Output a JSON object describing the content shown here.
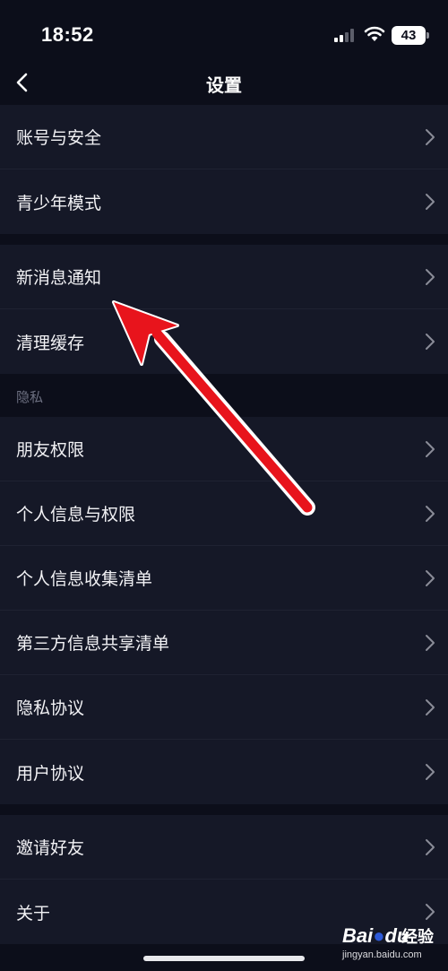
{
  "status_bar": {
    "time": "18:52",
    "battery": "43"
  },
  "nav": {
    "title": "设置",
    "back_icon": "chevron-left-icon"
  },
  "groups": [
    {
      "items": [
        {
          "label": "账号与安全"
        },
        {
          "label": "青少年模式"
        }
      ]
    },
    {
      "items": [
        {
          "label": "新消息通知"
        },
        {
          "label": "清理缓存"
        }
      ]
    },
    {
      "header": "隐私",
      "items": [
        {
          "label": "朋友权限"
        },
        {
          "label": "个人信息与权限"
        },
        {
          "label": "个人信息收集清单"
        },
        {
          "label": "第三方信息共享清单"
        },
        {
          "label": "隐私协议"
        },
        {
          "label": "用户协议"
        }
      ]
    },
    {
      "items": [
        {
          "label": "邀请好友"
        },
        {
          "label": "关于"
        }
      ]
    }
  ],
  "annotation": {
    "color": "#e8141c",
    "icon": "red-arrow-pointing-to-new-message-notification"
  },
  "watermark": {
    "logo_text": "Bai",
    "logo_suffix": "du",
    "label": "经验",
    "url": "jingyan.baidu.com"
  },
  "colors": {
    "background": "#0c0e1a",
    "row_background": "#151827",
    "divider": "#1f2232",
    "section_header": "#6c6f80"
  }
}
